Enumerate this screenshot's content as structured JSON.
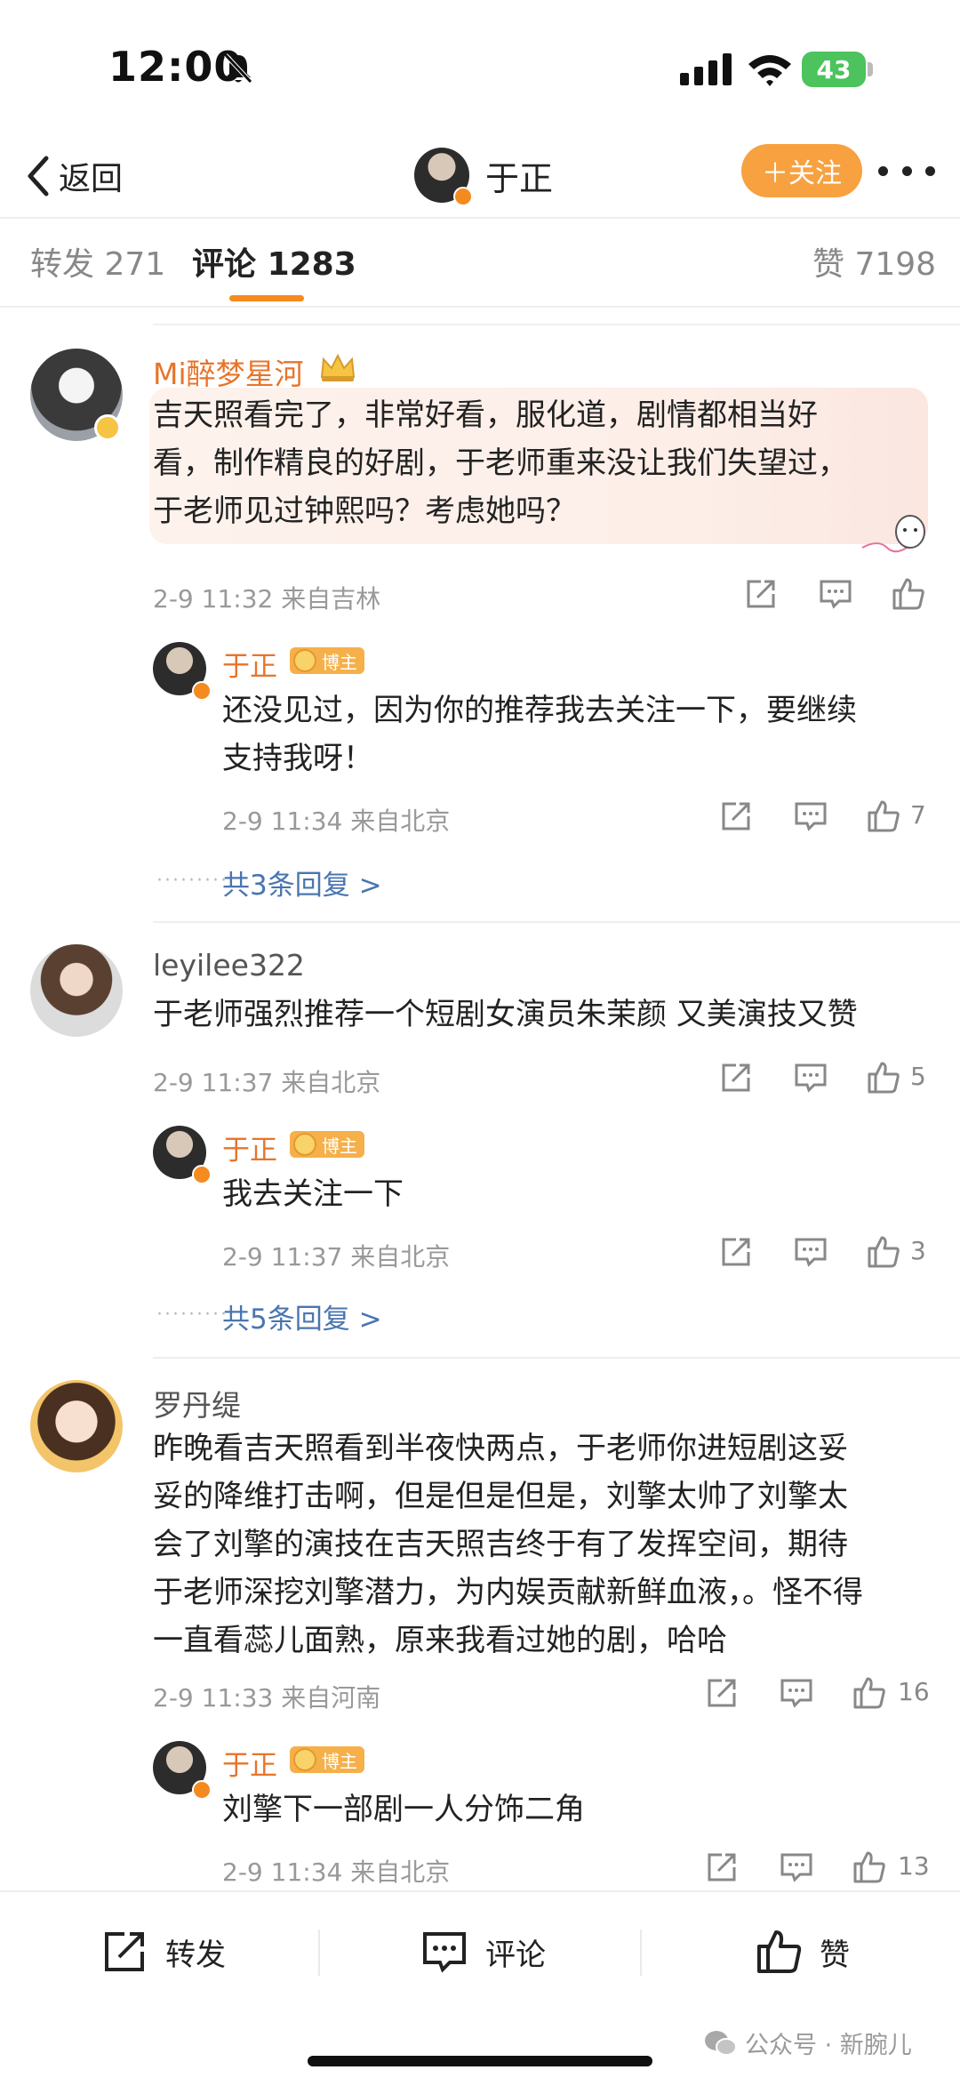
{
  "status_bar": {
    "time": "12:00",
    "battery": "43"
  },
  "nav": {
    "back_label": "返回",
    "account_name": "于正",
    "follow_label": "＋关注"
  },
  "tabs": [
    {
      "label": "转发",
      "count": "271"
    },
    {
      "label": "评论",
      "count": "1283"
    },
    {
      "label": "赞",
      "count": "7198"
    }
  ],
  "host_badge": "博主",
  "comments": [
    {
      "user": "Mi醉梦星河",
      "lines": [
        "吉天照看完了，非常好看，服化道，剧情都相当好",
        "看，制作精良的好剧，于老师重来没让我们失望过，",
        "于老师见过钟熙吗？考虑她吗？"
      ],
      "meta": "2-9 11:32  来自吉林",
      "likes": "",
      "reply": {
        "user": "于正",
        "lines": [
          "还没见过，因为你的推荐我去关注一下，要继续",
          "支持我呀！"
        ],
        "meta": "2-9 11:34  来自北京",
        "likes": "7"
      },
      "more_replies": "共3条回复 >"
    },
    {
      "user": "leyilee322",
      "lines": [
        "于老师强烈推荐一个短剧女演员朱茉颜 又美演技又赞"
      ],
      "meta": "2-9 11:37  来自北京",
      "likes": "5",
      "reply": {
        "user": "于正",
        "lines": [
          "我去关注一下"
        ],
        "meta": "2-9 11:37  来自北京",
        "likes": "3"
      },
      "more_replies": "共5条回复 >"
    },
    {
      "user": "罗丹缇",
      "lines": [
        "昨晚看吉天照看到半夜快两点，于老师你进短剧这妥",
        "妥的降维打击啊，但是但是但是，刘擎太帅了刘擎太",
        "会了刘擎的演技在吉天照吉终于有了发挥空间，期待",
        "于老师深挖刘擎潜力，为内娱贡献新鲜血液，。怪不得",
        "一直看蕊儿面熟，原来我看过她的剧，哈哈"
      ],
      "meta": "2-9 11:33  来自河南",
      "likes": "16",
      "reply": {
        "user": "于正",
        "lines": [
          "刘擎下一部剧一人分饰二角"
        ],
        "meta": "2-9 11:34  来自北京",
        "likes": "13"
      }
    }
  ],
  "bottom_bar": {
    "repost": "转发",
    "comment": "评论",
    "like": "赞"
  },
  "watermark": "公众号 · 新腕儿",
  "colors": {
    "accent": "#f58a1f",
    "username_orange": "#e8742a",
    "link_blue": "#4a75b0",
    "follow_bg": "#f7a140"
  }
}
